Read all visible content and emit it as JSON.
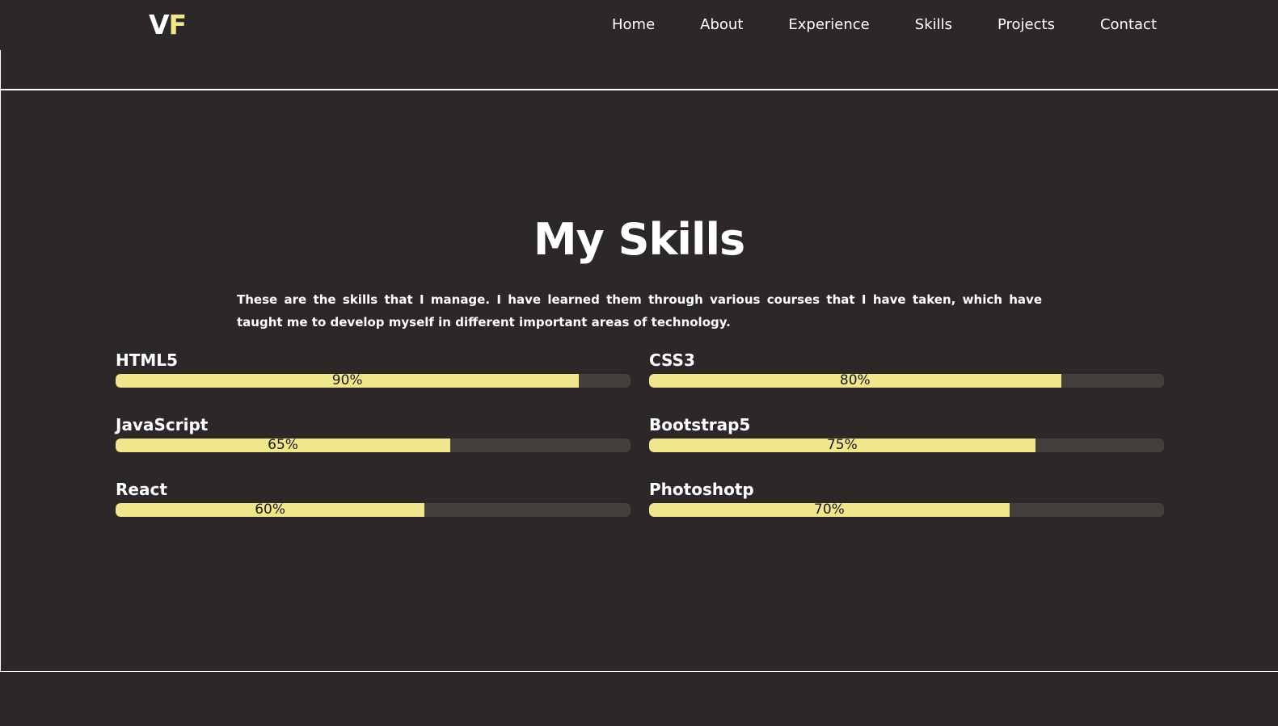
{
  "nav": {
    "logo_v": "V",
    "logo_f": "F",
    "links": [
      "Home",
      "About",
      "Experience",
      "Skills",
      "Projects",
      "Contact"
    ]
  },
  "skills_section": {
    "title": "My Skills",
    "description": "These are the skills that I manage. I have learned them through various courses that I have taken, which have taught me to develop myself in different important areas of technology.",
    "items": [
      {
        "name": "HTML5",
        "percent_label": "90%",
        "level": 90
      },
      {
        "name": "CSS3",
        "percent_label": "80%",
        "level": 80
      },
      {
        "name": "JavaScript",
        "percent_label": "65%",
        "level": 65
      },
      {
        "name": "Bootstrap5",
        "percent_label": "75%",
        "level": 75
      },
      {
        "name": "React",
        "percent_label": "60%",
        "level": 60
      },
      {
        "name": "Photoshotp",
        "percent_label": "70%",
        "level": 70
      }
    ]
  },
  "colors": {
    "background": "#2b2827",
    "accent": "#f0e68c",
    "bar_track": "#433f3c",
    "text": "#ffffff"
  }
}
